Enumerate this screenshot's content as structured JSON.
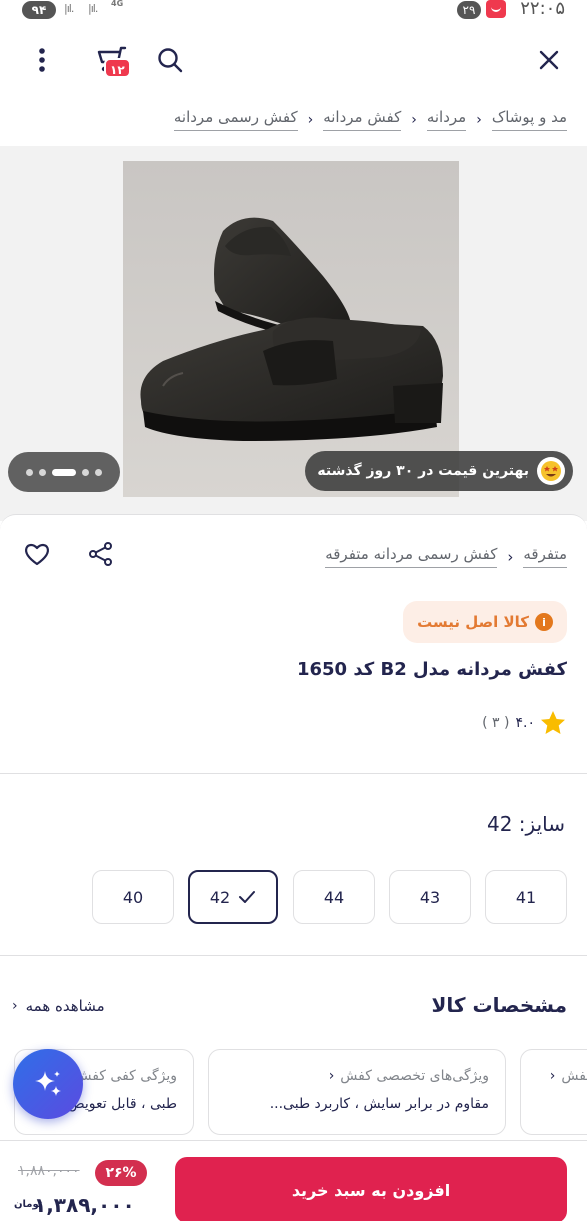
{
  "status_bar": {
    "battery": "۹۴",
    "network": "4G",
    "notification_count": "۲۹",
    "time": "۲۲:۰۵"
  },
  "header": {
    "cart_count": "۱۲"
  },
  "breadcrumb": [
    "مد و پوشاک",
    "مردانه",
    "کفش مردانه",
    "کفش رسمی مردانه"
  ],
  "gallery": {
    "best_price_badge": "بهترین قیمت در ۳۰ روز گذشته",
    "dot_count": 5,
    "active_dot": 3
  },
  "product": {
    "categories": [
      "متفرقه",
      "کفش رسمی مردانه متفرقه"
    ],
    "warning_badge": "کالا اصل نیست",
    "title": "کفش مردانه مدل B2 کد 1650",
    "rating": "۴.۰",
    "rating_count": "( ۳ )"
  },
  "size": {
    "label": "سایز: 42",
    "options": [
      "41",
      "43",
      "44",
      "42",
      "40"
    ],
    "selected": "42"
  },
  "specs": {
    "title": "مشخصات کالا",
    "see_all": "مشاهده همه",
    "cards": [
      {
        "caption": "کفش",
        "value": ""
      },
      {
        "caption": "ویژگی‌های تخصصی کفش",
        "value": "مقاوم در برابر سایش ، کاربرد طبی..."
      },
      {
        "caption": "ویژگی کفی کفش",
        "value": "طبی ، قابل تعویض"
      }
    ]
  },
  "purchase": {
    "discount": "۲۶%",
    "old_price": "۱,۸۸۰,۰۰۰",
    "final_price": "۱,۳۸۹,۰۰۰",
    "currency": "تومان",
    "add_to_cart": "افزودن به سبد خرید"
  },
  "colors": {
    "brand": "#ef394e",
    "cta": "#e0224f",
    "text": "#23254e",
    "muted": "#62666d"
  }
}
